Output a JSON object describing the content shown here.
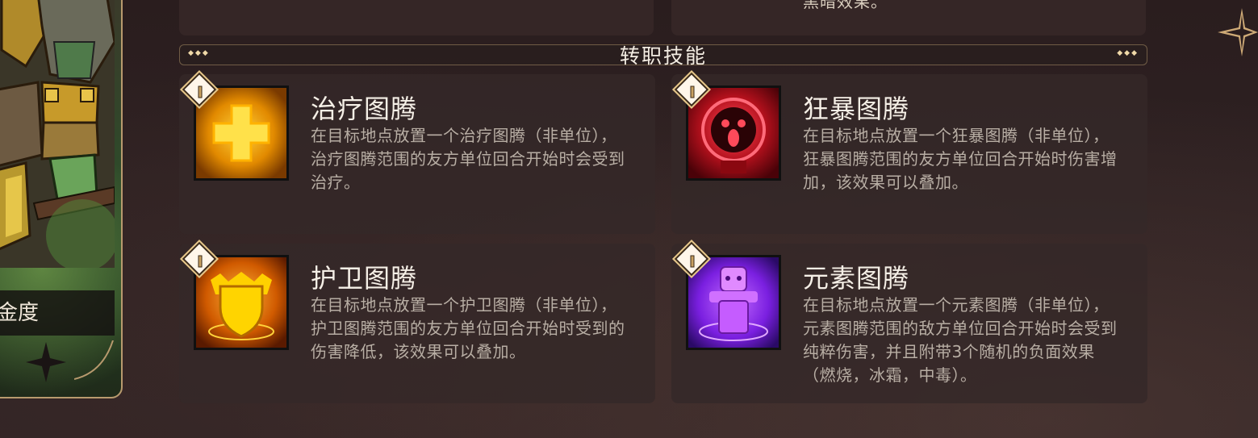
{
  "progress_label": "金度",
  "top_stub_text": "黑暗效果。",
  "section": {
    "title": "转职技能",
    "ornament": "◆◆◆"
  },
  "skills": [
    {
      "name": "治疗图腾",
      "description": "在目标地点放置一个治疗图腾（非单位），治疗图腾范围的友方单位回合开始时会受到治疗。",
      "icon": "healing-totem-icon",
      "color": "#f5a800"
    },
    {
      "name": "狂暴图腾",
      "description": "在目标地点放置一个狂暴图腾（非单位），狂暴图腾范围的友方单位回合开始时伤害增加，该效果可以叠加。",
      "icon": "rage-totem-icon",
      "color": "#d81b2a"
    },
    {
      "name": "护卫图腾",
      "description": "在目标地点放置一个护卫图腾（非单位），护卫图腾范围的友方单位回合开始时受到的伤害降低，该效果可以叠加。",
      "icon": "guard-totem-icon",
      "color": "#f07a00"
    },
    {
      "name": "元素图腾",
      "description": "在目标地点放置一个元素图腾（非单位），元素图腾范围的敌方单位回合开始时会受到纯粹伤害，并且附带3个随机的负面效果（燃烧，冰霜，中毒）。",
      "icon": "elemental-totem-icon",
      "color": "#9b2cf0"
    }
  ]
}
